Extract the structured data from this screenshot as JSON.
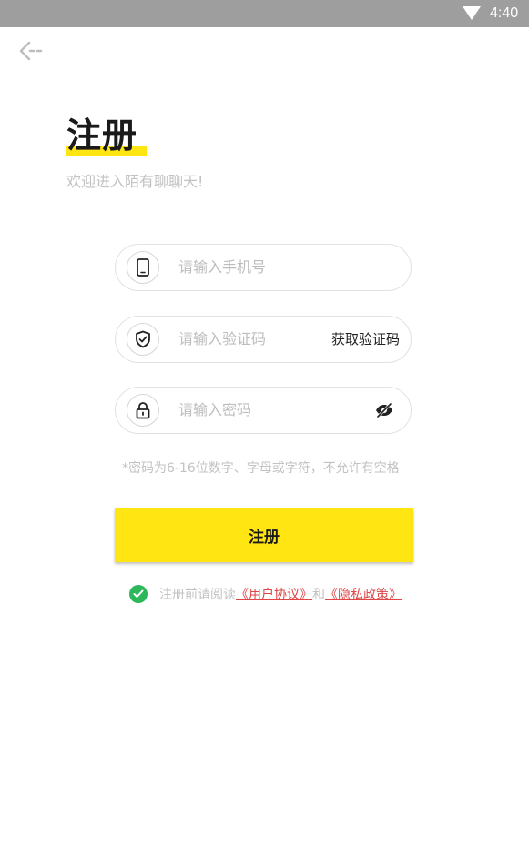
{
  "status_bar": {
    "time": "4:40"
  },
  "title": "注册",
  "subtitle": "欢迎进入陌有聊聊天!",
  "phone_field": {
    "placeholder": "请输入手机号"
  },
  "code_field": {
    "placeholder": "请输入验证码",
    "get_code_label": "获取验证码"
  },
  "password_field": {
    "placeholder": "请输入密码"
  },
  "password_hint": "*密码为6-16位数字、字母或字符，不允许有空格",
  "submit_label": "注册",
  "agreement": {
    "prefix": "注册前请阅读",
    "user_agreement": "《用户协议》",
    "and": "和",
    "privacy_policy": "《隐私政策》"
  },
  "colors": {
    "accent": "#ffe511",
    "check": "#2bb75a",
    "link": "#e04545"
  }
}
